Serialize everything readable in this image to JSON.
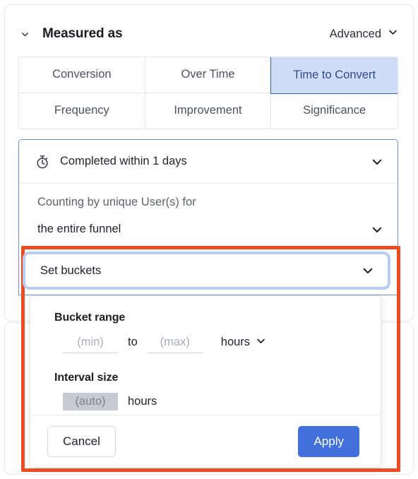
{
  "section": {
    "title": "Measured as",
    "collapse_icon": "chevron-down-icon",
    "advanced_label": "Advanced",
    "advanced_icon": "chevron-down-icon"
  },
  "tabs": [
    {
      "label": "Conversion",
      "selected": false
    },
    {
      "label": "Over Time",
      "selected": false
    },
    {
      "label": "Time to Convert",
      "selected": true
    },
    {
      "label": "Frequency",
      "selected": false
    },
    {
      "label": "Improvement",
      "selected": false
    },
    {
      "label": "Significance",
      "selected": false
    }
  ],
  "measure_panel": {
    "timer_icon": "stopwatch-icon",
    "completed_label": "Completed within 1 days",
    "completed_chevron": "chevron-down-icon",
    "counting_label": "Counting by unique User(s) for",
    "funnel_label": "the entire funnel",
    "funnel_chevron": "chevron-down-icon"
  },
  "set_buckets": {
    "label": "Set buckets",
    "chevron": "chevron-down-icon"
  },
  "buckets_popover": {
    "bucket_range_label": "Bucket range",
    "min_placeholder": "(min)",
    "min_value": "",
    "max_placeholder": "(max)",
    "max_value": "",
    "to_label": "to",
    "range_unit": "hours",
    "range_unit_chevron": "chevron-down-icon",
    "interval_label": "Interval size",
    "interval_placeholder": "(auto)",
    "interval_value": "",
    "interval_unit": "hours",
    "cancel_label": "Cancel",
    "apply_label": "Apply"
  },
  "colors": {
    "accent_blue": "#4170da",
    "selected_tab_bg": "#cfddf8",
    "selected_tab_text": "#2f4a8c",
    "annotation_red": "#ee4b23",
    "focus_ring": "#b9cdf2"
  }
}
